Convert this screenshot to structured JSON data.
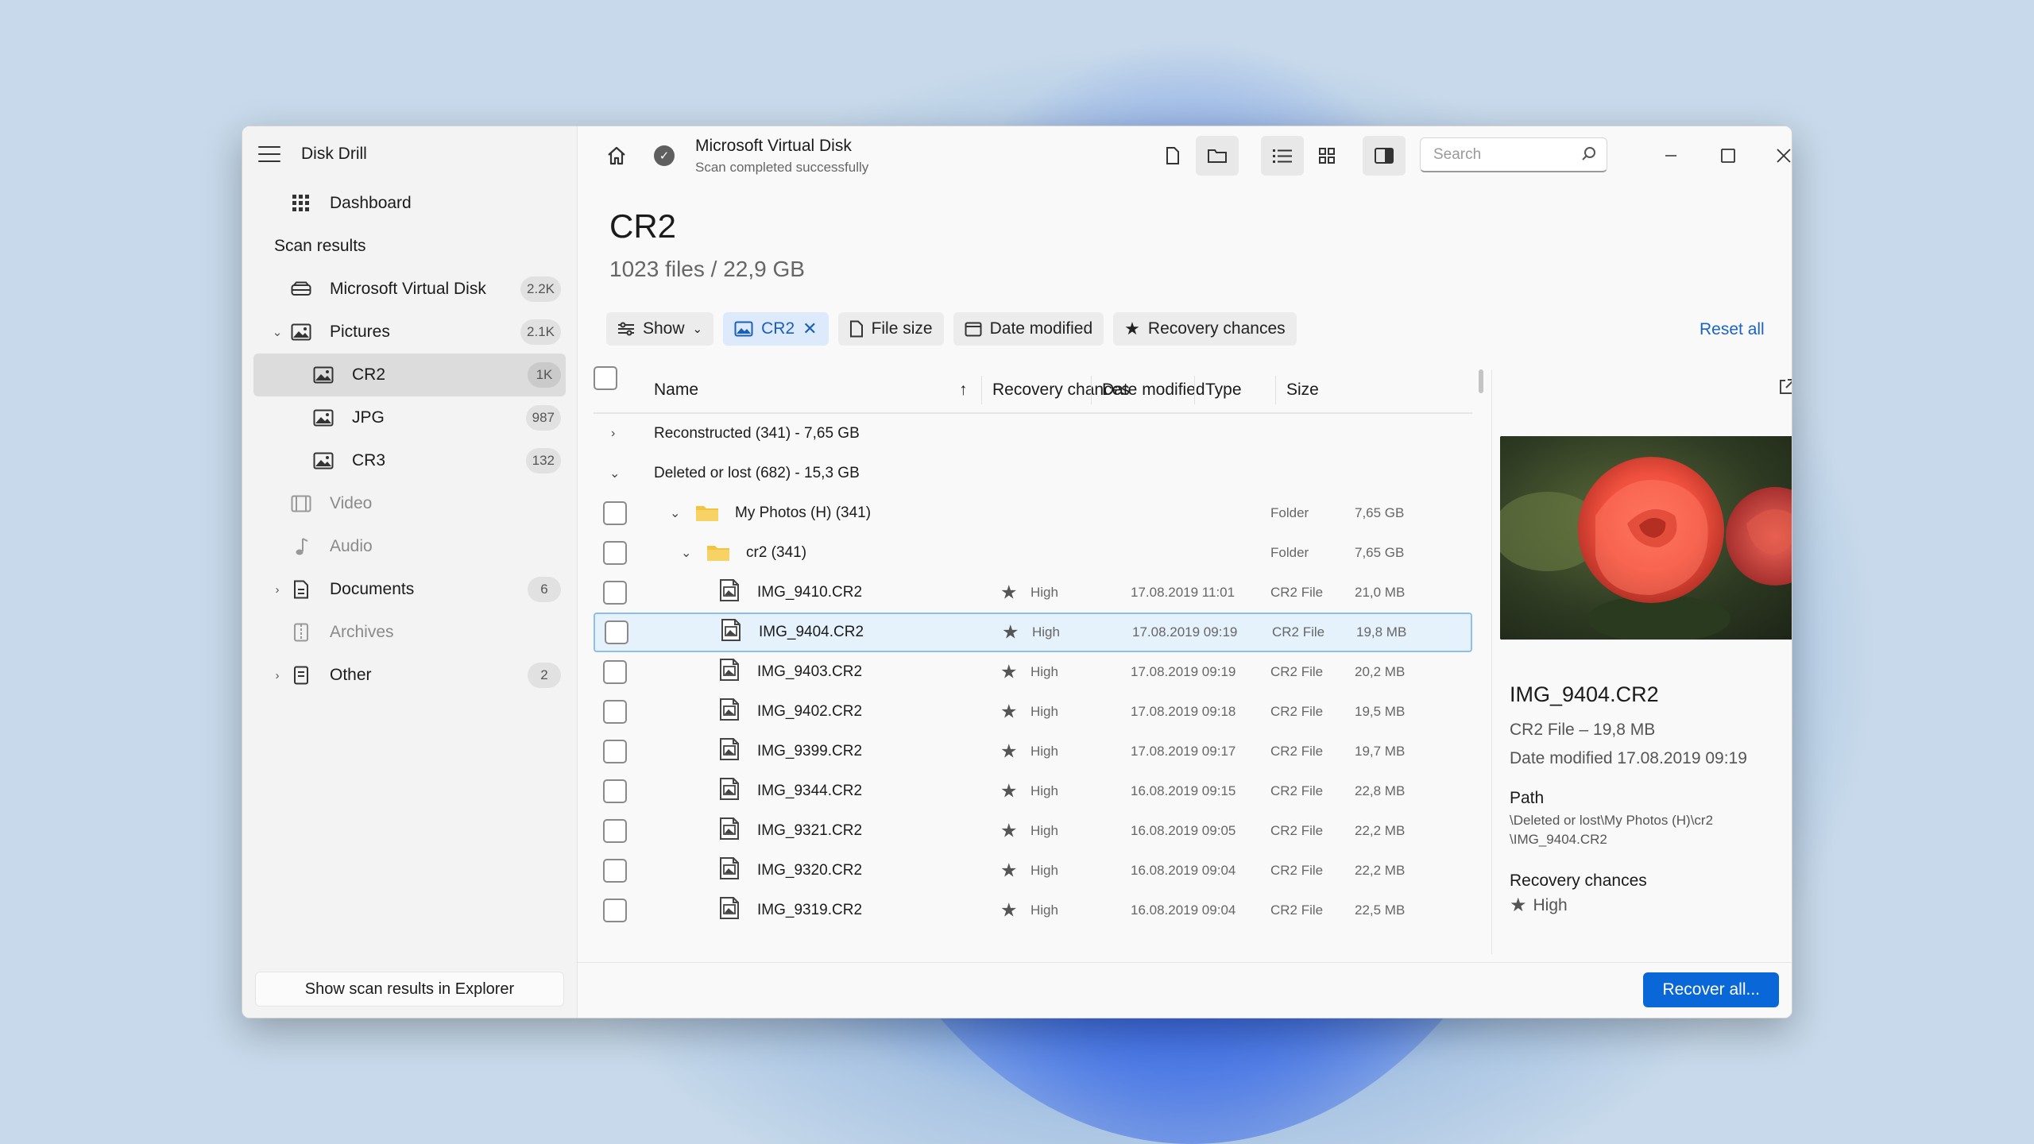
{
  "app": {
    "title": "Disk Drill"
  },
  "sidebar": {
    "dashboard": "Dashboard",
    "section": "Scan results",
    "items": [
      {
        "label": "Microsoft Virtual Disk",
        "badge": "2.2K",
        "icon": "disk-icon"
      },
      {
        "label": "Pictures",
        "badge": "2.1K",
        "icon": "image-icon"
      },
      {
        "label": "CR2",
        "badge": "1K",
        "icon": "image-icon"
      },
      {
        "label": "JPG",
        "badge": "987",
        "icon": "image-icon"
      },
      {
        "label": "CR3",
        "badge": "132",
        "icon": "image-icon"
      },
      {
        "label": "Video",
        "icon": "film-icon"
      },
      {
        "label": "Audio",
        "icon": "music-icon"
      },
      {
        "label": "Documents",
        "badge": "6",
        "icon": "document-icon"
      },
      {
        "label": "Archives",
        "icon": "archive-icon"
      },
      {
        "label": "Other",
        "badge": "2",
        "icon": "other-icon"
      }
    ],
    "footer_button": "Show scan results in Explorer"
  },
  "header": {
    "disk_name": "Microsoft Virtual Disk",
    "status": "Scan completed successfully",
    "search_placeholder": "Search"
  },
  "page": {
    "title": "CR2",
    "subtitle": "1023 files / 22,9 GB"
  },
  "filters": {
    "show": "Show",
    "cr2": "CR2",
    "file_size": "File size",
    "date_modified": "Date modified",
    "recovery_chances": "Recovery chances",
    "reset_all": "Reset all"
  },
  "table": {
    "columns": {
      "name": "Name",
      "recovery": "Recovery chances",
      "date": "Date modified",
      "type": "Type",
      "size": "Size"
    },
    "groups": [
      {
        "label": "Reconstructed (341) - 7,65 GB"
      },
      {
        "label": "Deleted or lost (682) - 15,3 GB"
      }
    ],
    "folders": [
      {
        "name": "My Photos (H) (341)",
        "type": "Folder",
        "size": "7,65 GB"
      },
      {
        "name": "cr2 (341)",
        "type": "Folder",
        "size": "7,65 GB"
      }
    ],
    "files": [
      {
        "name": "IMG_9410.CR2",
        "recovery": "High",
        "date": "17.08.2019 11:01",
        "type": "CR2 File",
        "size": "21,0 MB"
      },
      {
        "name": "IMG_9404.CR2",
        "recovery": "High",
        "date": "17.08.2019 09:19",
        "type": "CR2 File",
        "size": "19,8 MB"
      },
      {
        "name": "IMG_9403.CR2",
        "recovery": "High",
        "date": "17.08.2019 09:19",
        "type": "CR2 File",
        "size": "20,2 MB"
      },
      {
        "name": "IMG_9402.CR2",
        "recovery": "High",
        "date": "17.08.2019 09:18",
        "type": "CR2 File",
        "size": "19,5 MB"
      },
      {
        "name": "IMG_9399.CR2",
        "recovery": "High",
        "date": "17.08.2019 09:17",
        "type": "CR2 File",
        "size": "19,7 MB"
      },
      {
        "name": "IMG_9344.CR2",
        "recovery": "High",
        "date": "16.08.2019 09:15",
        "type": "CR2 File",
        "size": "22,8 MB"
      },
      {
        "name": "IMG_9321.CR2",
        "recovery": "High",
        "date": "16.08.2019 09:05",
        "type": "CR2 File",
        "size": "22,2 MB"
      },
      {
        "name": "IMG_9320.CR2",
        "recovery": "High",
        "date": "16.08.2019 09:04",
        "type": "CR2 File",
        "size": "22,2 MB"
      },
      {
        "name": "IMG_9319.CR2",
        "recovery": "High",
        "date": "16.08.2019 09:04",
        "type": "CR2 File",
        "size": "22,5 MB"
      }
    ]
  },
  "preview": {
    "name": "IMG_9404.CR2",
    "type_size": "CR2 File – 19,8 MB",
    "date": "Date modified 17.08.2019 09:19",
    "path_label": "Path",
    "path_line1": "\\Deleted or lost\\My Photos (H)\\cr2",
    "path_line2": "\\IMG_9404.CR2",
    "recovery_label": "Recovery chances",
    "recovery_value": "High"
  },
  "actions": {
    "recover_all": "Recover all..."
  },
  "colors": {
    "accent": "#0a67d8",
    "selection": "#e5f1fb",
    "folder": "#f4c342"
  }
}
